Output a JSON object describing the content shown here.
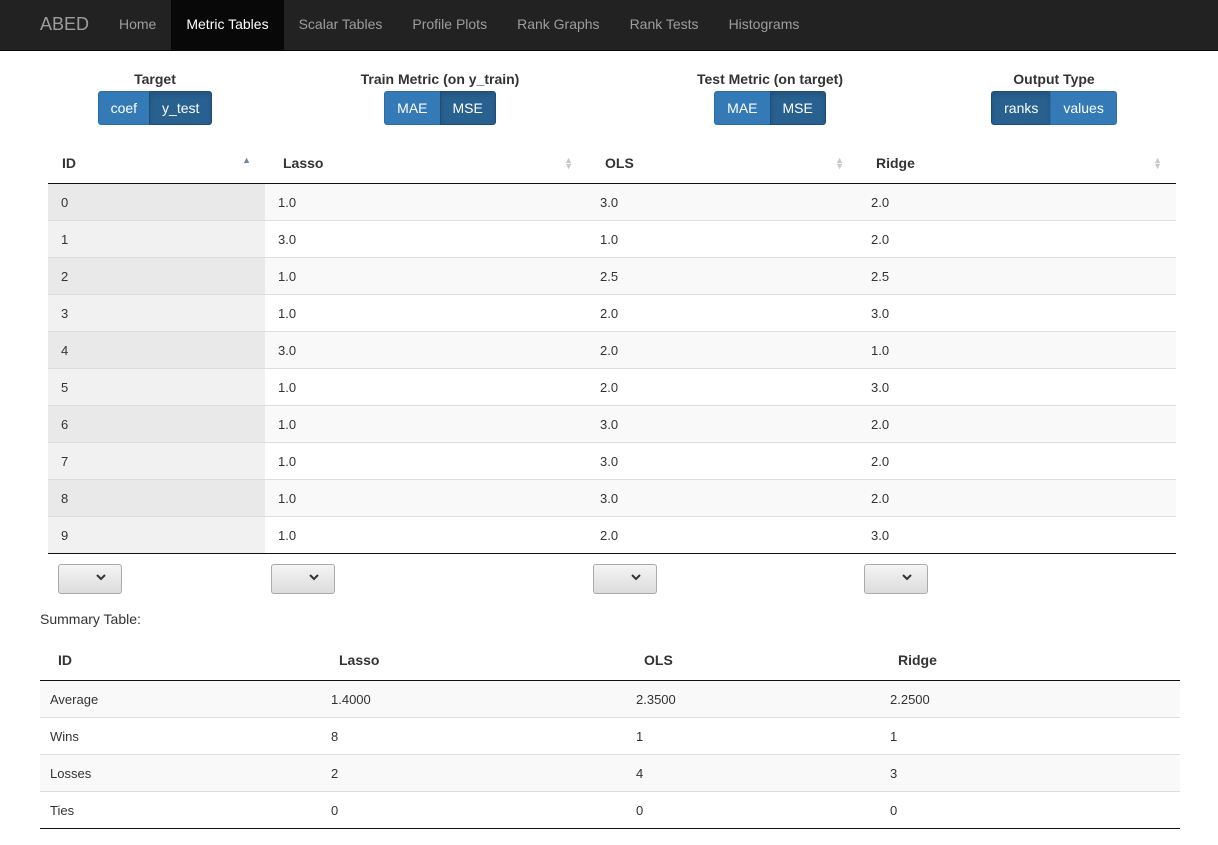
{
  "navbar": {
    "brand": "ABED",
    "items": [
      "Home",
      "Metric Tables",
      "Scalar Tables",
      "Profile Plots",
      "Rank Graphs",
      "Rank Tests",
      "Histograms"
    ],
    "active_index": 1
  },
  "controls": {
    "target": {
      "label": "Target",
      "options": [
        "coef",
        "y_test"
      ],
      "active": "y_test"
    },
    "train_metric": {
      "label": "Train Metric (on y_train)",
      "options": [
        "MAE",
        "MSE"
      ],
      "active": "MSE"
    },
    "test_metric": {
      "label": "Test Metric (on target)",
      "options": [
        "MAE",
        "MSE"
      ],
      "active": "MSE"
    },
    "output_type": {
      "label": "Output Type",
      "options": [
        "ranks",
        "values"
      ],
      "active": "ranks"
    }
  },
  "metric_table": {
    "headers": [
      "ID",
      "Lasso",
      "OLS",
      "Ridge"
    ],
    "sorted_column": "ID",
    "rows": [
      [
        "0",
        "1.0",
        "3.0",
        "2.0"
      ],
      [
        "1",
        "3.0",
        "1.0",
        "2.0"
      ],
      [
        "2",
        "1.0",
        "2.5",
        "2.5"
      ],
      [
        "3",
        "1.0",
        "2.0",
        "3.0"
      ],
      [
        "4",
        "3.0",
        "2.0",
        "1.0"
      ],
      [
        "5",
        "1.0",
        "2.0",
        "3.0"
      ],
      [
        "6",
        "1.0",
        "3.0",
        "2.0"
      ],
      [
        "7",
        "1.0",
        "3.0",
        "2.0"
      ],
      [
        "8",
        "1.0",
        "3.0",
        "2.0"
      ],
      [
        "9",
        "1.0",
        "2.0",
        "3.0"
      ]
    ]
  },
  "summary": {
    "label": "Summary Table:",
    "headers": [
      "ID",
      "Lasso",
      "OLS",
      "Ridge"
    ],
    "rows": [
      [
        "Average",
        "1.4000",
        "2.3500",
        "2.2500"
      ],
      [
        "Wins",
        "8",
        "1",
        "1"
      ],
      [
        "Losses",
        "2",
        "4",
        "3"
      ],
      [
        "Ties",
        "0",
        "0",
        "0"
      ]
    ]
  },
  "icons": {
    "sort": "sort-icon",
    "dropdown": "chevron-down-icon"
  }
}
